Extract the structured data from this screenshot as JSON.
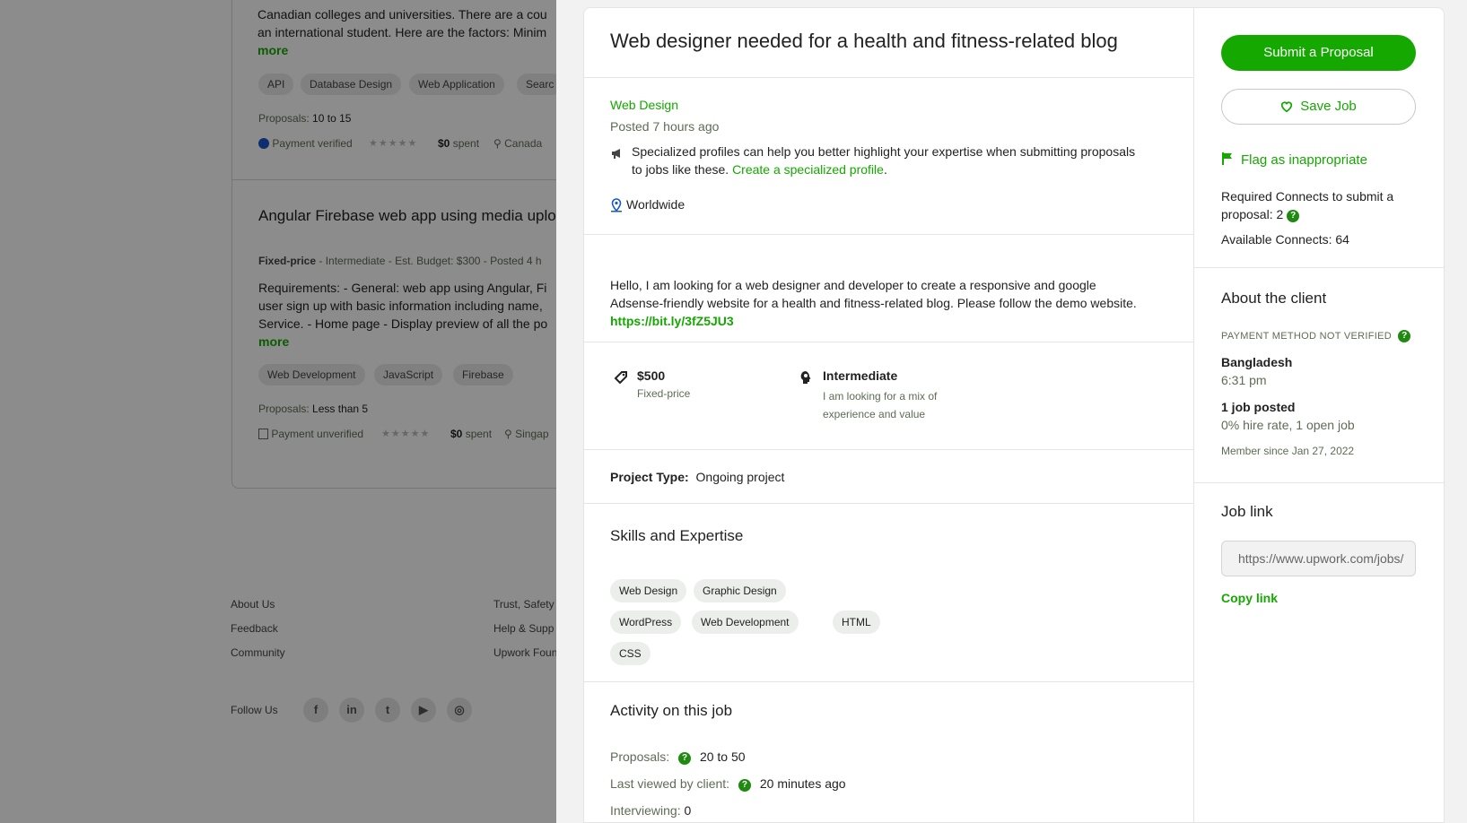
{
  "background": {
    "job1": {
      "desc_line1": "Canadian colleges and universities. There are a cou",
      "desc_line2": "an international student. Here are the factors: Minim",
      "more": "more",
      "tags": [
        "API",
        "Database Design",
        "Web Application",
        "Searc"
      ],
      "proposals_label": "Proposals:",
      "proposals_value": "10 to 15",
      "payment": "Payment verified",
      "spent_amount": "$0",
      "spent_label": "spent",
      "location": "Canada"
    },
    "job2": {
      "title": "Angular Firebase web app using media uploa",
      "meta_type": "Fixed-price",
      "meta_rest": "- Intermediate - Est. Budget: $300 - Posted 4 h",
      "desc_line1": "Requirements: - General: web app using Angular, Fi",
      "desc_line2": "user sign up with basic information including name,",
      "desc_line3": "Service. - Home page - Display preview of all the po",
      "more": "more",
      "tags": [
        "Web Development",
        "JavaScript",
        "Firebase"
      ],
      "proposals_label": "Proposals:",
      "proposals_value": "Less than 5",
      "payment": "Payment unverified",
      "spent_amount": "$0",
      "spent_label": "spent",
      "location": "Singap"
    },
    "footer": {
      "col1": [
        "About Us",
        "Feedback",
        "Community"
      ],
      "col2": [
        "Trust, Safety",
        "Help & Supp",
        "Upwork Foun"
      ],
      "follow_us": "Follow Us",
      "social": [
        "facebook",
        "linkedin",
        "twitter",
        "youtube",
        "instagram"
      ]
    }
  },
  "job": {
    "title": "Web designer needed for a health and fitness-related blog",
    "category": "Web Design",
    "posted": "Posted 7 hours ago",
    "specialized_text_line1": "Specialized profiles can help you better highlight your expertise when submitting proposals",
    "specialized_text_line2": "to jobs like these.",
    "specialized_link": "Create a specialized profile",
    "location": "Worldwide",
    "description_line1": "Hello, I am looking for a web designer and developer to create a responsive and google",
    "description_line2": "Adsense-friendly website for a health and fitness-related blog. Please follow the demo website.",
    "description_link": "https://bit.ly/3fZ5JU3",
    "budget": "$500",
    "budget_type": "Fixed-price",
    "level": "Intermediate",
    "level_desc_line1": "I am looking for a mix of",
    "level_desc_line2": "experience and value",
    "project_type_label": "Project Type:",
    "project_type_value": "Ongoing project",
    "skills_heading": "Skills and Expertise",
    "skills": [
      "Web Design",
      "Graphic Design",
      "WordPress",
      "Web Development",
      "HTML",
      "CSS"
    ],
    "activity_heading": "Activity on this job",
    "activity": {
      "proposals_label": "Proposals:",
      "proposals_value": "20 to 50",
      "last_viewed_label": "Last viewed by client:",
      "last_viewed_value": "20 minutes ago",
      "interviewing_label": "Interviewing:",
      "interviewing_value": "0"
    }
  },
  "sidebar": {
    "submit_label": "Submit a Proposal",
    "save_label": "Save Job",
    "flag_label": "Flag as inappropriate",
    "connects_required_line1": "Required Connects to submit a",
    "connects_required_line2": "proposal: 2",
    "connects_available": "Available Connects: 64",
    "client_heading": "About the client",
    "payment_status": "PAYMENT METHOD NOT VERIFIED",
    "client_country": "Bangladesh",
    "client_time": "6:31 pm",
    "jobs_posted": "1 job posted",
    "hire_rate": "0% hire rate, 1 open job",
    "member_since": "Member since Jan 27, 2022",
    "job_link_heading": "Job link",
    "job_link_value": "https://www.upwork.com/jobs/",
    "copy_link": "Copy link"
  },
  "colors": {
    "accent": "#14a800",
    "overlay": "rgba(0,0,0,0.45)"
  }
}
